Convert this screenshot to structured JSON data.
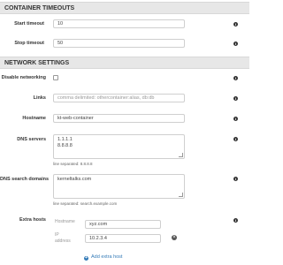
{
  "container_timeouts": {
    "title": "Container Timeouts",
    "start_timeout": {
      "label": "Start timeout",
      "value": "10"
    },
    "stop_timeout": {
      "label": "Stop timeout",
      "value": "50"
    }
  },
  "network_settings": {
    "title": "Network Settings",
    "disable_networking": {
      "label": "Disable networking",
      "checked": false
    },
    "links": {
      "label": "Links",
      "placeholder": "comma delimited: othercontainer:alias, db:db"
    },
    "hostname": {
      "label": "Hostname",
      "value": "kt-web-container"
    },
    "dns_servers": {
      "label": "DNS servers",
      "lines": [
        "1.1.1.1",
        "8.8.8.8"
      ],
      "help": "line separated: 8.8.8.8"
    },
    "dns_search_domains": {
      "label": "DNS search domains",
      "lines": [
        "kerneltalks.com"
      ],
      "help": "line separated: search.example.com"
    },
    "extra_hosts": {
      "label": "Extra hosts",
      "hostname_label": "Hostname",
      "hostname_value": "xyz.com",
      "ip_label_1": "IP",
      "ip_label_2": "address",
      "ip_value": "10.2.3.4",
      "add_label": "Add extra host"
    }
  },
  "icons": {
    "info": "info-icon",
    "remove": "remove-icon",
    "add": "add-icon"
  }
}
